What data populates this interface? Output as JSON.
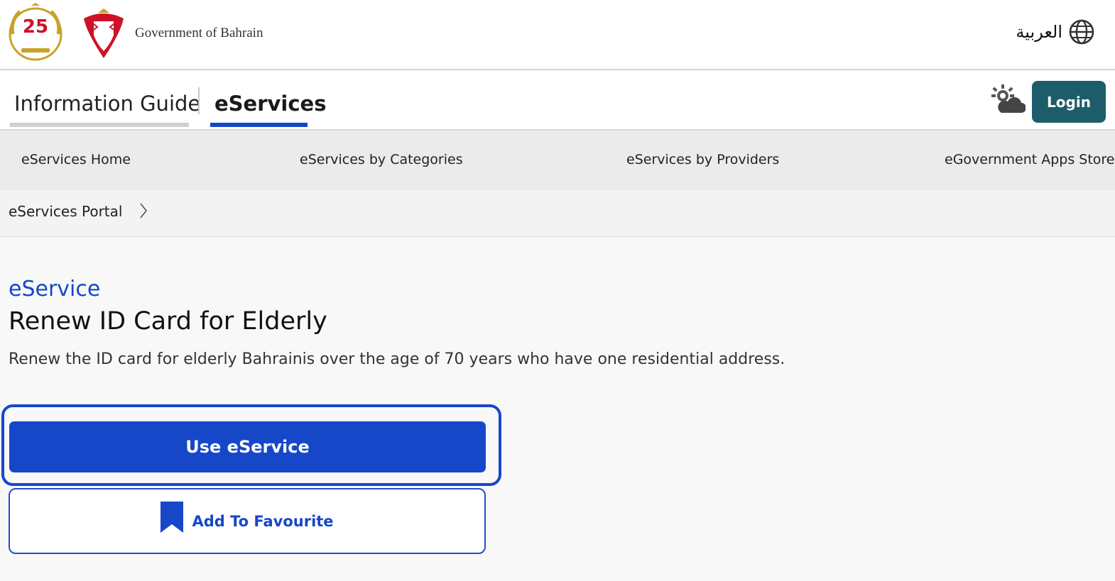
{
  "header": {
    "logo_25_text": "25",
    "gov_name": "Government of Bahrain",
    "language_label": "العربية"
  },
  "tabs": {
    "info_guide": "Information Guide",
    "eservices": "eServices",
    "login": "Login"
  },
  "subnav": {
    "items": [
      "eServices Home",
      "eServices by Categories",
      "eServices by Providers",
      "eGovernment Apps Store"
    ]
  },
  "breadcrumb": {
    "item": "eServices Portal"
  },
  "content": {
    "kicker": "eService",
    "title": "Renew ID Card for Elderly",
    "description": "Renew the ID card for elderly Bahrainis over the age of 70 years who have one residential address.",
    "use_button": "Use eService",
    "favourite_button": "Add To Favourite"
  },
  "colors": {
    "primary_blue": "#1747c9",
    "login_teal": "#1d5d6b",
    "gold": "#c9a227",
    "bahrain_red": "#ce1126"
  },
  "icons": {
    "language": "globe-icon",
    "weather": "weather-sun-cloud-icon",
    "breadcrumb_sep": "chevron-right-icon",
    "favourite": "bookmark-icon"
  }
}
